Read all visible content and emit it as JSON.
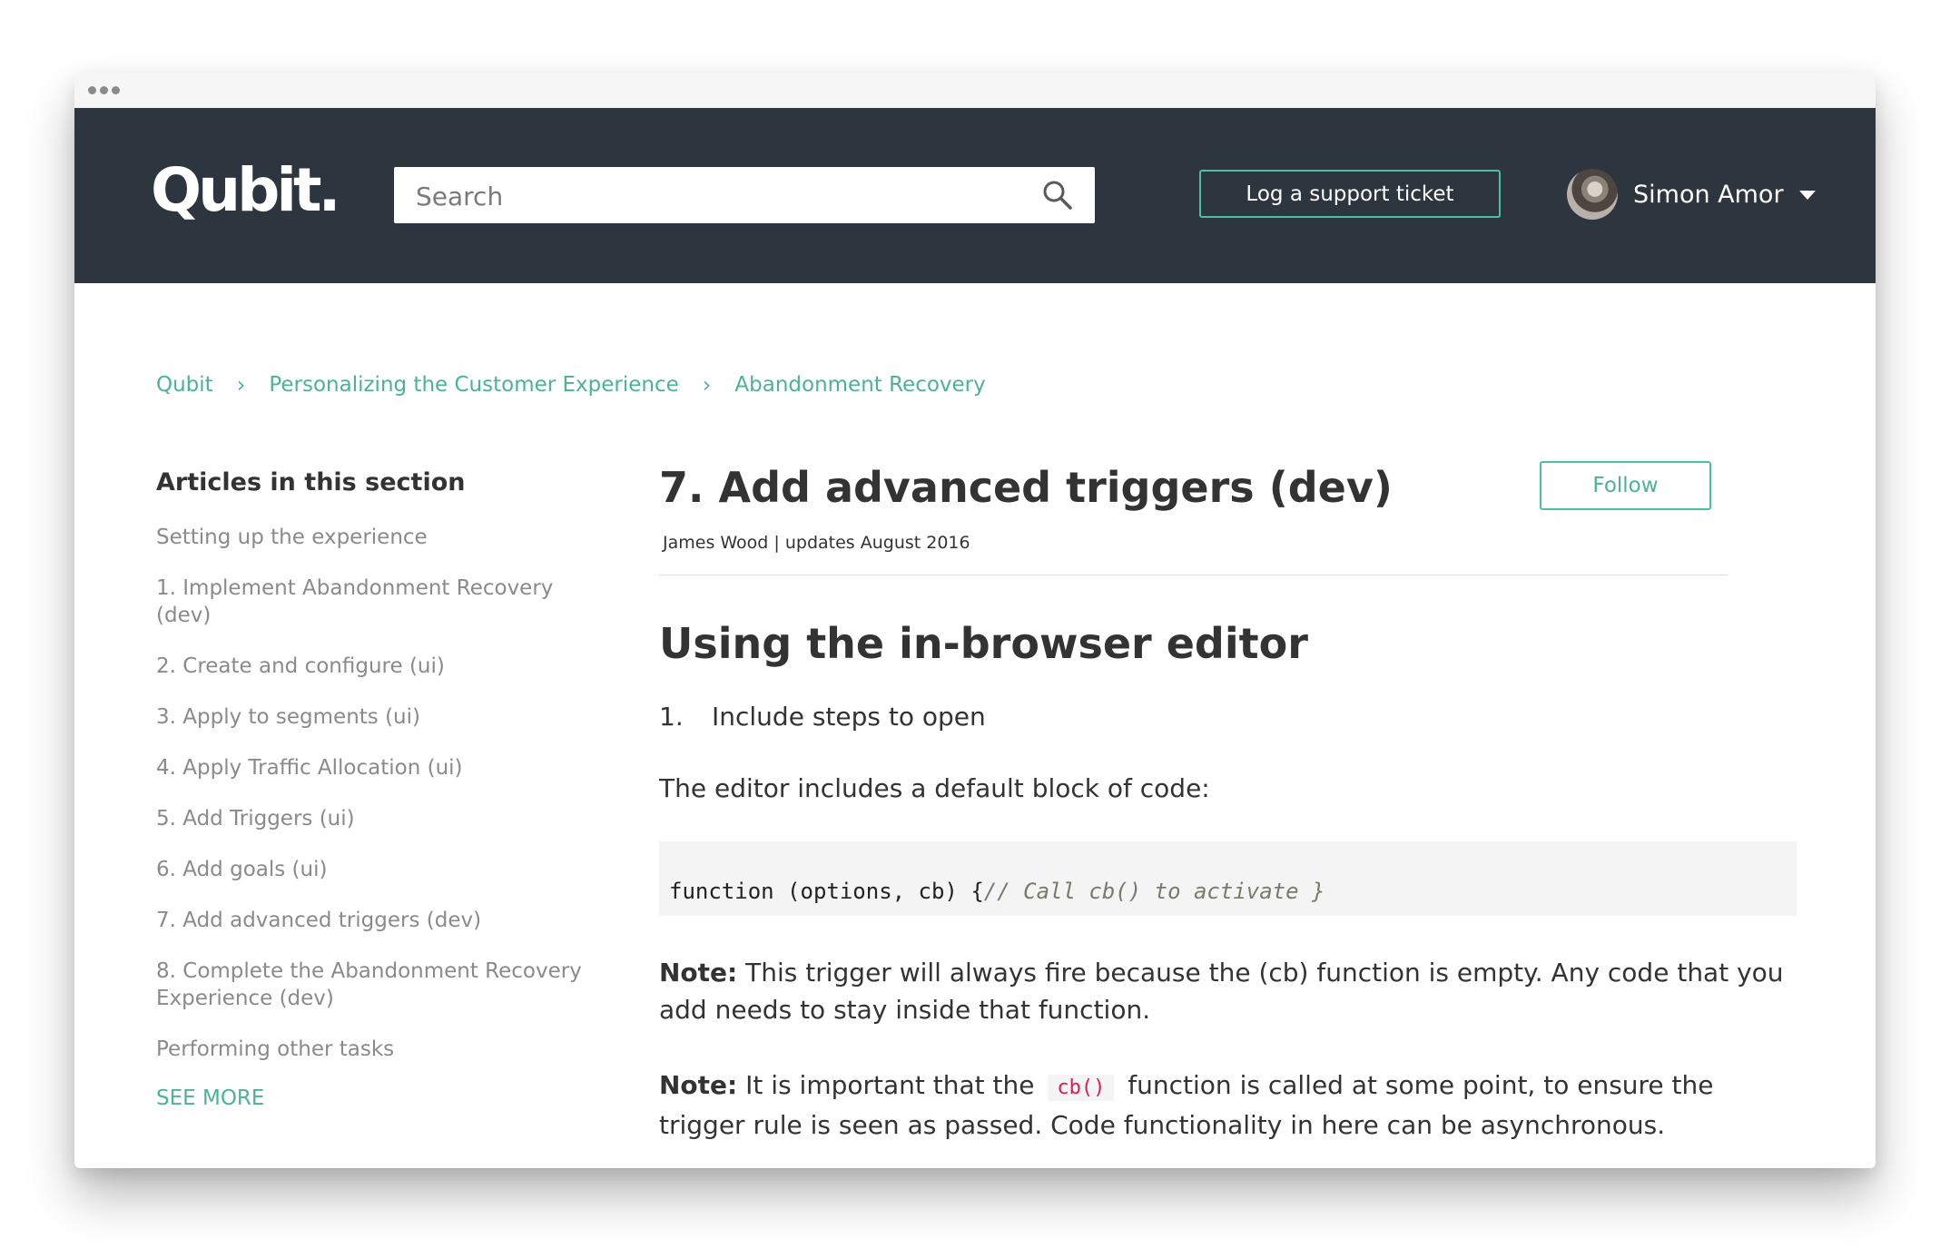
{
  "header": {
    "logo_text": "Qubit.",
    "search_placeholder": "Search",
    "ticket_button": "Log a support ticket",
    "user_name": "Simon Amor"
  },
  "breadcrumb": {
    "items": [
      "Qubit",
      "Personalizing the Customer Experience",
      "Abandonment Recovery"
    ],
    "separator": "›"
  },
  "sidebar": {
    "title": "Articles in this section",
    "items": [
      "Setting up the experience",
      "1. Implement Abandonment Recovery (dev)",
      "2. Create and configure (ui)",
      "3. Apply to segments (ui)",
      "4. Apply Traffic Allocation (ui)",
      "5. Add Triggers (ui)",
      "6. Add goals (ui)",
      "7. Add advanced triggers (dev)",
      "8. Complete the Abandonment Recovery Experience (dev)",
      "Performing other tasks"
    ],
    "see_more": "SEE MORE"
  },
  "article": {
    "title": "7. Add advanced triggers (dev)",
    "follow_label": "Follow",
    "meta": "James Wood | updates August 2016",
    "section_title": "Using the in-browser editor",
    "step_number": "1.",
    "step_text": "Include steps to open",
    "intro": "The editor includes a default block of code:",
    "code_main": "function (options, cb) {",
    "code_comment": "// Call cb() to activate }",
    "note1_label": "Note:",
    "note1_text": " This trigger will always fire because the (cb) function is empty.  Any code that you add needs to stay inside that function.",
    "note2_label": "Note:",
    "note2_before": " It is important that the ",
    "note2_code": "cb()",
    "note2_after": " function is called at some point, to ensure the trigger rule is seen as passed. Code functionality in here can be asynchronous."
  },
  "colors": {
    "header_bg": "#2d353f",
    "accent": "#4bb394",
    "text": "#333333",
    "muted": "#8a8a8a"
  },
  "icons": [
    "window-dot-icon",
    "search-icon",
    "caret-down-icon",
    "chevron-right-icon"
  ]
}
